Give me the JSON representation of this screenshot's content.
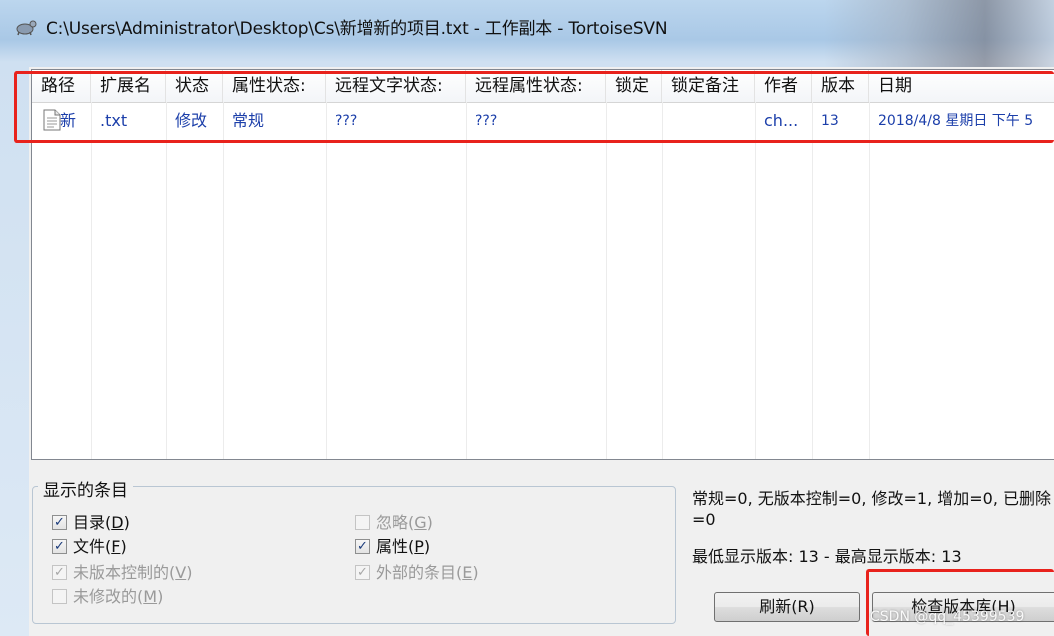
{
  "window": {
    "title": "C:\\Users\\Administrator\\Desktop\\Cs\\新增新的项目.txt - 工作副本 - TortoiseSVN"
  },
  "list": {
    "columns": [
      "路径",
      "扩展名",
      "状态",
      "属性状态:",
      "远程文字状态:",
      "远程属性状态:",
      "锁定",
      "锁定备注",
      "作者",
      "版本",
      "日期"
    ],
    "rows": [
      {
        "path": "新",
        "ext": ".txt",
        "status": "修改",
        "prop_status": "常规",
        "remote_text_status": "???",
        "remote_prop_status": "???",
        "lock": "",
        "lock_comment": "",
        "author": "ch...",
        "revision": "13",
        "date": "2018/4/8 星期日 下午 5"
      }
    ]
  },
  "shown_items": {
    "legend": "显示的条目",
    "options": [
      {
        "label": "目录",
        "key": "D",
        "checked": true,
        "enabled": true
      },
      {
        "label": "文件",
        "key": "F",
        "checked": true,
        "enabled": true
      },
      {
        "label": "未版本控制的",
        "key": "V",
        "checked": true,
        "enabled": false
      },
      {
        "label": "未修改的",
        "key": "M",
        "checked": false,
        "enabled": false
      },
      {
        "label": "忽略",
        "key": "G",
        "checked": false,
        "enabled": false
      },
      {
        "label": "属性",
        "key": "P",
        "checked": true,
        "enabled": true
      },
      {
        "label": "外部的条目",
        "key": "E",
        "checked": true,
        "enabled": false
      }
    ]
  },
  "stats": {
    "line1": "常规=0, 无版本控制=0, 修改=1, 增加=0, 已删除",
    "line2": "=0",
    "revision_range": "最低显示版本: 13 - 最高显示版本: 13"
  },
  "buttons": {
    "refresh": "刷新(R)",
    "check_repo": "检查版本库(H)"
  },
  "watermark": "CSDN @qq_45399539"
}
